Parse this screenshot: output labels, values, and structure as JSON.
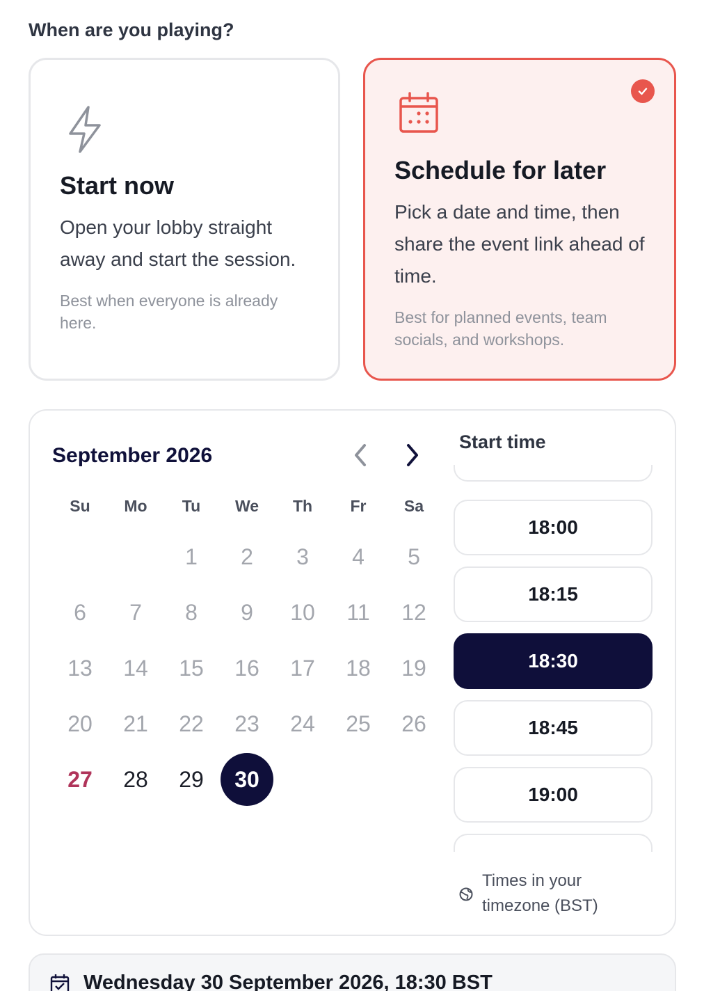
{
  "question": "When are you playing?",
  "options": [
    {
      "title": "Start now",
      "description": "Open your lobby straight away and start the session.",
      "note": "Best when everyone is already here.",
      "icon": "lightning-icon",
      "selected": false
    },
    {
      "title": "Schedule for later",
      "description": "Pick a date and time, then share the event link ahead of time.",
      "note": "Best for planned events, team socials, and workshops.",
      "icon": "calendar-icon",
      "selected": true
    }
  ],
  "calendar": {
    "month_label": "September 2026",
    "weekdays": [
      "Su",
      "Mo",
      "Tu",
      "We",
      "Th",
      "Fr",
      "Sa"
    ],
    "first_weekday_index": 2,
    "days_in_month": 30,
    "today": 27,
    "selected": 30,
    "first_available": 27
  },
  "start_time": {
    "label": "Start time",
    "slots": [
      "",
      "18:00",
      "18:15",
      "18:30",
      "18:45",
      "19:00",
      ""
    ],
    "selected": "18:30"
  },
  "timezone_note": "Times in your timezone (BST)",
  "summary": "Wednesday 30 September 2026, 18:30 BST",
  "colors": {
    "accent": "#e8564d",
    "selected_bg": "#0f0f3a",
    "today": "#b0345a",
    "card_selected_bg": "#fdf0ef"
  }
}
